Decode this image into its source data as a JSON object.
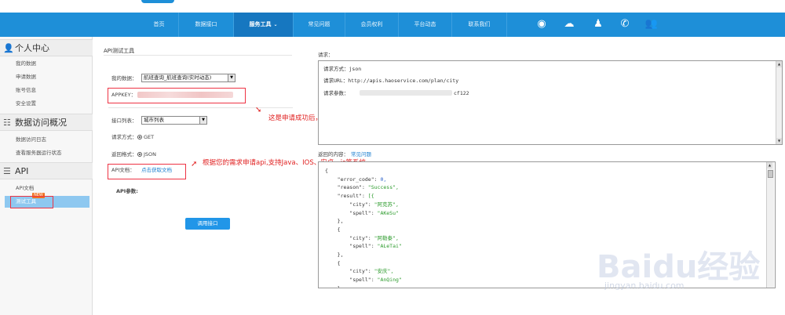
{
  "nav": {
    "items": [
      "首页",
      "数据接口",
      "服务工具",
      "常见问题",
      "会员权利",
      "平台动态",
      "联系我们"
    ],
    "active_index": 2,
    "icons": [
      "weibo-icon",
      "wechat-icon",
      "qq-icon",
      "phone-icon",
      "user-icon"
    ]
  },
  "sidebar": {
    "sections": [
      {
        "title": "个人中心",
        "icon": "user-icon",
        "items": [
          "我的数据",
          "申请数据",
          "账号信息",
          "安全设置"
        ]
      },
      {
        "title": "数据访问概况",
        "icon": "list-icon",
        "items": [
          "数据访问日志",
          "查看服务器运行状态"
        ]
      },
      {
        "title": "API",
        "icon": "menu-icon",
        "items": [
          "API文档",
          "测试工具"
        ]
      }
    ],
    "active_item": "测试工具",
    "new_badge": "NEW"
  },
  "main": {
    "title": "API测试工具",
    "my_data_label": "我的数据：",
    "my_data_value": "航班查询_航班查询(实时动态)",
    "appkey_label": "APPKEY：",
    "interface_label": "接口列表：",
    "interface_value": "城市列表",
    "method_label": "请求方式：",
    "method_value": "GET",
    "format_label": "返回格式：",
    "format_value": "JSON",
    "doc_label": "API文档：",
    "doc_link": "点击获取文档",
    "params_label": "API参数:",
    "call_button": "调用接口"
  },
  "annotations": {
    "key_note": "这是申请成功后，系统返回的key",
    "api_note": "根据您的需求申请api,支持Java、IOS、安卓、js等系统"
  },
  "request": {
    "label": "请求：",
    "method_line": "请求方式：json",
    "url_line": "请求URL：http://apis.haoservice.com/plan/city",
    "params_prefix": "请求参数：",
    "params_suffix": "cf122"
  },
  "response": {
    "label": "返回的内容：",
    "faq_link": "常见问题",
    "lines": [
      "{",
      "    \"error_code\": 0,",
      "    \"reason\": \"Success\",",
      "    \"result\": [{",
      "        \"city\": \"阿克苏\",",
      "        \"spell\": \"AKeSu\"",
      "    },",
      "    {",
      "        \"city\": \"阿勒泰\",",
      "        \"spell\": \"ALeTai\"",
      "    },",
      "    {",
      "        \"city\": \"安庆\",",
      "        \"spell\": \"AnQing\"",
      "    },"
    ]
  },
  "watermark": {
    "logo": "Baidu经验",
    "url": "jingyan.baidu.com"
  },
  "colors": {
    "nav_blue": "#1e8fd8",
    "accent_red": "#e02020",
    "button_blue": "#2196e8"
  }
}
